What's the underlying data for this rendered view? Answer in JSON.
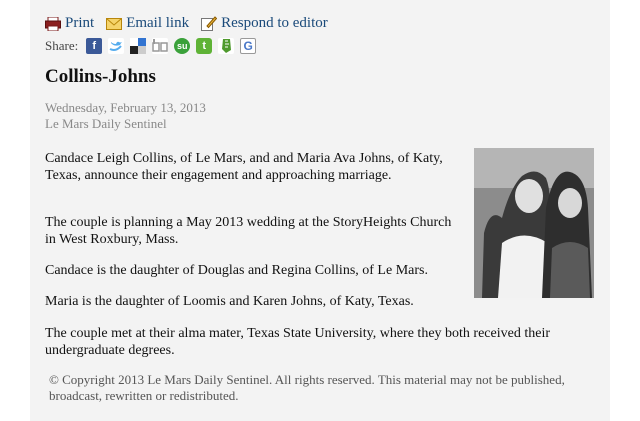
{
  "toolbar": {
    "print_label": "Print",
    "email_label": "Email link",
    "respond_label": "Respond to editor"
  },
  "share": {
    "label": "Share:",
    "icons": [
      "facebook-icon",
      "twitter-icon",
      "delicious-icon",
      "digg-icon",
      "stumbleupon-icon",
      "technorati-icon",
      "evernote-icon",
      "google-icon"
    ]
  },
  "article": {
    "headline": "Collins-Johns",
    "date": "Wednesday, February 13, 2013",
    "source": "Le Mars Daily Sentinel",
    "paragraphs": [
      "Candace Leigh Collins, of Le Mars, and and Maria Ava Johns, of Katy, Texas, announce their engagement and approaching marriage.",
      "The couple is planning a May 2013 wedding at the StoryHeights Church in West Roxbury, Mass.",
      "Candace is the daughter of Douglas and Regina Collins, of Le Mars.",
      "Maria is the daughter of Loomis and Karen Johns, of Katy, Texas.",
      "The couple met at their alma mater, Texas State University, where they both received their undergraduate degrees."
    ],
    "copyright": "© Copyright 2013 Le Mars Daily Sentinel. All rights reserved. This material may not be published, broadcast, rewritten or redistributed."
  },
  "colors": {
    "link": "#1a4a7a",
    "background": "#f3f3f3"
  }
}
